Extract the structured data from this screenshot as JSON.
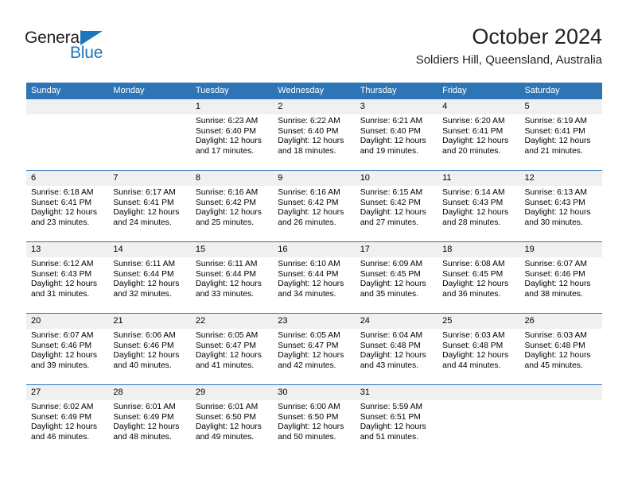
{
  "logo": {
    "word_one": "General",
    "word_two": "Blue",
    "triangle_color": "#1c76bc",
    "text_color": "#231f20"
  },
  "header": {
    "title": "October 2024",
    "subtitle": "Soldiers Hill, Queensland, Australia"
  },
  "theme": {
    "header_blue": "#2e75b6",
    "daynum_gray": "#f0f0f0",
    "rule_blue": "#2e75b6"
  },
  "calendar": {
    "weekday_headers": [
      "Sunday",
      "Monday",
      "Tuesday",
      "Wednesday",
      "Thursday",
      "Friday",
      "Saturday"
    ],
    "weeks": [
      [
        {
          "day": "",
          "lines": []
        },
        {
          "day": "",
          "lines": []
        },
        {
          "day": "1",
          "lines": [
            "Sunrise: 6:23 AM",
            "Sunset: 6:40 PM",
            "Daylight: 12 hours",
            "and 17 minutes."
          ]
        },
        {
          "day": "2",
          "lines": [
            "Sunrise: 6:22 AM",
            "Sunset: 6:40 PM",
            "Daylight: 12 hours",
            "and 18 minutes."
          ]
        },
        {
          "day": "3",
          "lines": [
            "Sunrise: 6:21 AM",
            "Sunset: 6:40 PM",
            "Daylight: 12 hours",
            "and 19 minutes."
          ]
        },
        {
          "day": "4",
          "lines": [
            "Sunrise: 6:20 AM",
            "Sunset: 6:41 PM",
            "Daylight: 12 hours",
            "and 20 minutes."
          ]
        },
        {
          "day": "5",
          "lines": [
            "Sunrise: 6:19 AM",
            "Sunset: 6:41 PM",
            "Daylight: 12 hours",
            "and 21 minutes."
          ]
        }
      ],
      [
        {
          "day": "6",
          "lines": [
            "Sunrise: 6:18 AM",
            "Sunset: 6:41 PM",
            "Daylight: 12 hours",
            "and 23 minutes."
          ]
        },
        {
          "day": "7",
          "lines": [
            "Sunrise: 6:17 AM",
            "Sunset: 6:41 PM",
            "Daylight: 12 hours",
            "and 24 minutes."
          ]
        },
        {
          "day": "8",
          "lines": [
            "Sunrise: 6:16 AM",
            "Sunset: 6:42 PM",
            "Daylight: 12 hours",
            "and 25 minutes."
          ]
        },
        {
          "day": "9",
          "lines": [
            "Sunrise: 6:16 AM",
            "Sunset: 6:42 PM",
            "Daylight: 12 hours",
            "and 26 minutes."
          ]
        },
        {
          "day": "10",
          "lines": [
            "Sunrise: 6:15 AM",
            "Sunset: 6:42 PM",
            "Daylight: 12 hours",
            "and 27 minutes."
          ]
        },
        {
          "day": "11",
          "lines": [
            "Sunrise: 6:14 AM",
            "Sunset: 6:43 PM",
            "Daylight: 12 hours",
            "and 28 minutes."
          ]
        },
        {
          "day": "12",
          "lines": [
            "Sunrise: 6:13 AM",
            "Sunset: 6:43 PM",
            "Daylight: 12 hours",
            "and 30 minutes."
          ]
        }
      ],
      [
        {
          "day": "13",
          "lines": [
            "Sunrise: 6:12 AM",
            "Sunset: 6:43 PM",
            "Daylight: 12 hours",
            "and 31 minutes."
          ]
        },
        {
          "day": "14",
          "lines": [
            "Sunrise: 6:11 AM",
            "Sunset: 6:44 PM",
            "Daylight: 12 hours",
            "and 32 minutes."
          ]
        },
        {
          "day": "15",
          "lines": [
            "Sunrise: 6:11 AM",
            "Sunset: 6:44 PM",
            "Daylight: 12 hours",
            "and 33 minutes."
          ]
        },
        {
          "day": "16",
          "lines": [
            "Sunrise: 6:10 AM",
            "Sunset: 6:44 PM",
            "Daylight: 12 hours",
            "and 34 minutes."
          ]
        },
        {
          "day": "17",
          "lines": [
            "Sunrise: 6:09 AM",
            "Sunset: 6:45 PM",
            "Daylight: 12 hours",
            "and 35 minutes."
          ]
        },
        {
          "day": "18",
          "lines": [
            "Sunrise: 6:08 AM",
            "Sunset: 6:45 PM",
            "Daylight: 12 hours",
            "and 36 minutes."
          ]
        },
        {
          "day": "19",
          "lines": [
            "Sunrise: 6:07 AM",
            "Sunset: 6:46 PM",
            "Daylight: 12 hours",
            "and 38 minutes."
          ]
        }
      ],
      [
        {
          "day": "20",
          "lines": [
            "Sunrise: 6:07 AM",
            "Sunset: 6:46 PM",
            "Daylight: 12 hours",
            "and 39 minutes."
          ]
        },
        {
          "day": "21",
          "lines": [
            "Sunrise: 6:06 AM",
            "Sunset: 6:46 PM",
            "Daylight: 12 hours",
            "and 40 minutes."
          ]
        },
        {
          "day": "22",
          "lines": [
            "Sunrise: 6:05 AM",
            "Sunset: 6:47 PM",
            "Daylight: 12 hours",
            "and 41 minutes."
          ]
        },
        {
          "day": "23",
          "lines": [
            "Sunrise: 6:05 AM",
            "Sunset: 6:47 PM",
            "Daylight: 12 hours",
            "and 42 minutes."
          ]
        },
        {
          "day": "24",
          "lines": [
            "Sunrise: 6:04 AM",
            "Sunset: 6:48 PM",
            "Daylight: 12 hours",
            "and 43 minutes."
          ]
        },
        {
          "day": "25",
          "lines": [
            "Sunrise: 6:03 AM",
            "Sunset: 6:48 PM",
            "Daylight: 12 hours",
            "and 44 minutes."
          ]
        },
        {
          "day": "26",
          "lines": [
            "Sunrise: 6:03 AM",
            "Sunset: 6:48 PM",
            "Daylight: 12 hours",
            "and 45 minutes."
          ]
        }
      ],
      [
        {
          "day": "27",
          "lines": [
            "Sunrise: 6:02 AM",
            "Sunset: 6:49 PM",
            "Daylight: 12 hours",
            "and 46 minutes."
          ]
        },
        {
          "day": "28",
          "lines": [
            "Sunrise: 6:01 AM",
            "Sunset: 6:49 PM",
            "Daylight: 12 hours",
            "and 48 minutes."
          ]
        },
        {
          "day": "29",
          "lines": [
            "Sunrise: 6:01 AM",
            "Sunset: 6:50 PM",
            "Daylight: 12 hours",
            "and 49 minutes."
          ]
        },
        {
          "day": "30",
          "lines": [
            "Sunrise: 6:00 AM",
            "Sunset: 6:50 PM",
            "Daylight: 12 hours",
            "and 50 minutes."
          ]
        },
        {
          "day": "31",
          "lines": [
            "Sunrise: 5:59 AM",
            "Sunset: 6:51 PM",
            "Daylight: 12 hours",
            "and 51 minutes."
          ]
        },
        {
          "day": "",
          "lines": []
        },
        {
          "day": "",
          "lines": []
        }
      ]
    ]
  }
}
